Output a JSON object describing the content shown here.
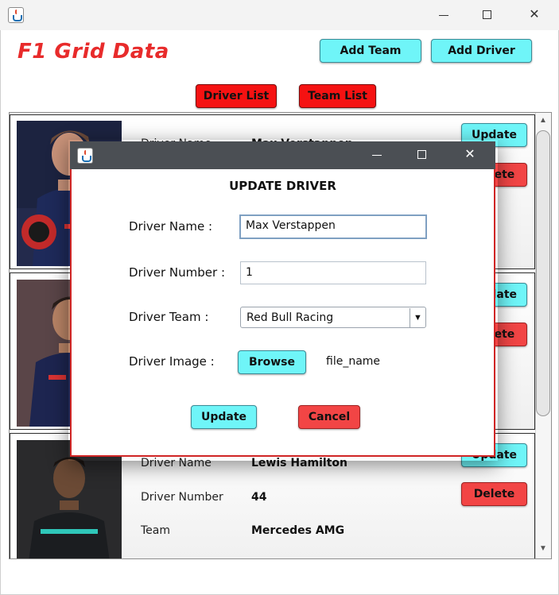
{
  "window": {
    "controls": {
      "minimize": "",
      "maximize": "",
      "close": "✕"
    }
  },
  "header": {
    "app_title": "F1 Grid Data",
    "add_team_label": "Add Team",
    "add_driver_label": "Add Driver",
    "driver_list_label": "Driver List",
    "team_list_label": "Team List"
  },
  "cards": [
    {
      "driver_name_label": "Driver Name",
      "driver_name": "Max Verstappen",
      "update_label": "Update",
      "delete_label": "Delete"
    },
    {
      "update_label": "Update",
      "delete_label": "Delete"
    },
    {
      "driver_name_label": "Driver Name",
      "driver_name": "Lewis Hamilton",
      "driver_number_label": "Driver Number",
      "driver_number": "44",
      "team_label": "Team",
      "team": "Mercedes AMG",
      "update_label": "Update",
      "delete_label": "Delete"
    }
  ],
  "scrollbar": {
    "up_arrow": "▲",
    "down_arrow": "▼"
  },
  "dialog": {
    "title": "UPDATE DRIVER",
    "controls": {
      "minimize": "",
      "maximize": "",
      "close": "✕"
    },
    "name_label": "Driver Name :",
    "name_value": "Max Verstappen",
    "number_label": "Driver Number :",
    "number_value": "1",
    "team_label": "Driver Team :",
    "team_value": "Red Bull Racing",
    "image_label": "Driver Image :",
    "browse_label": "Browse",
    "file_name": "file_name",
    "update_label": "Update",
    "cancel_label": "Cancel"
  },
  "icons": {
    "app": "java-cup-icon",
    "minimize": "minimize-icon",
    "maximize": "maximize-icon",
    "close": "close-icon",
    "dropdown": "chevron-down-icon"
  },
  "colors": {
    "accent_red": "#e82b2b",
    "cyan_button": "#6ff5f8",
    "red_button": "#f24545",
    "dialog_border": "#d02525",
    "dialog_titlebar": "#4b4f54"
  }
}
